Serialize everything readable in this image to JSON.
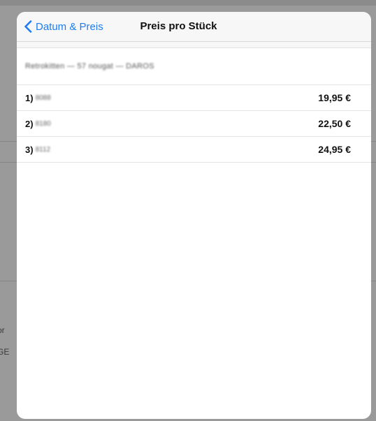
{
  "backdrop": {
    "text_1": "or",
    "text_2": "GE"
  },
  "navbar": {
    "back_label": "Datum & Preis",
    "title": "Preis pro Stück"
  },
  "section": {
    "header_blurred": "Retrokitten — 57 nougat — DAROS"
  },
  "rows": [
    {
      "index": "1)",
      "code": "8088",
      "price": "19,95 €"
    },
    {
      "index": "2)",
      "code": "8180",
      "price": "22,50 €"
    },
    {
      "index": "3)",
      "code": "8112",
      "price": "24,95 €"
    }
  ]
}
